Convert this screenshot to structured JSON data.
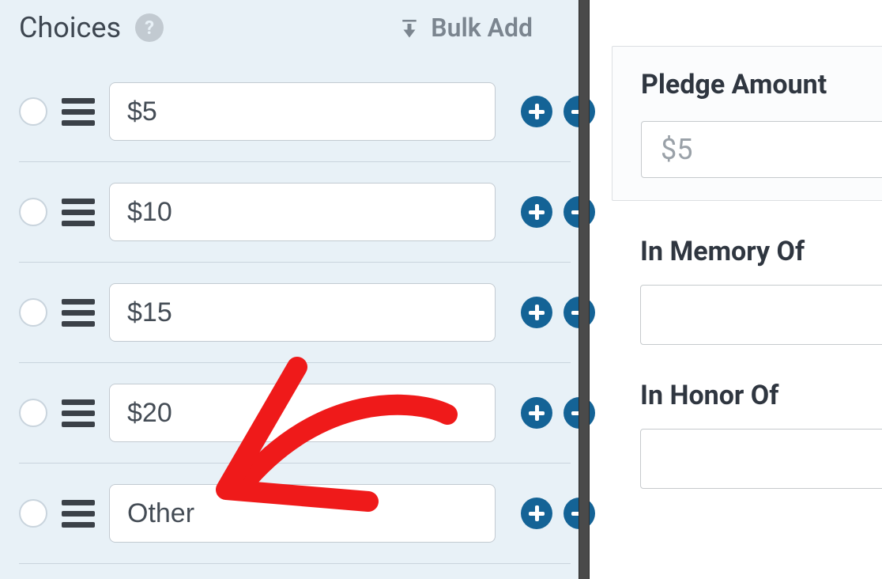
{
  "section": {
    "title": "Choices",
    "bulk_add_label": "Bulk Add"
  },
  "choices": [
    {
      "value": "$5"
    },
    {
      "value": "$10"
    },
    {
      "value": "$15"
    },
    {
      "value": "$20"
    },
    {
      "value": "Other"
    }
  ],
  "preview": {
    "pledge_label": "Pledge Amount",
    "pledge_value": "$5",
    "memory_label": "In Memory Of",
    "honor_label": "In Honor Of"
  },
  "colors": {
    "accent": "#146396"
  }
}
